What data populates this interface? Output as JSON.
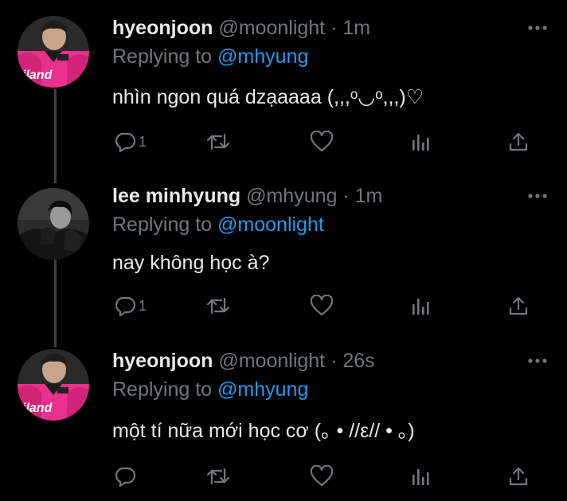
{
  "tweets": [
    {
      "name": "hyeonjoon",
      "handle": "@moonlight",
      "sep": "·",
      "time": "1m",
      "replying_prefix": "Replying to",
      "replying_to": "@mhyung",
      "text": "nhìn ngon quá dzạaaaa (,,,ᵒ◡ᵒ,,,)♡",
      "reply_count": "1",
      "avatar": "pink-jersey-avatar"
    },
    {
      "name": "lee minhyung",
      "handle": "@mhyung",
      "sep": "·",
      "time": "1m",
      "replying_prefix": "Replying to",
      "replying_to": "@moonlight",
      "text": "nay không học à?",
      "reply_count": "1",
      "avatar": "monochrome-avatar"
    },
    {
      "name": "hyeonjoon",
      "handle": "@moonlight",
      "sep": "·",
      "time": "26s",
      "replying_prefix": "Replying to",
      "replying_to": "@mhyung",
      "text": "một tí nữa mới học cơ (｡ • //ε// • ｡)",
      "reply_count": "",
      "avatar": "pink-jersey-avatar"
    }
  ],
  "avatar_label": "iland",
  "icons": {
    "more": "more-icon",
    "reply": "reply-icon",
    "retweet": "retweet-icon",
    "like": "heart-icon",
    "views": "views-icon",
    "share": "share-icon"
  },
  "colors": {
    "background": "#000000",
    "text": "#e7e9ea",
    "secondary": "#71767b",
    "accent": "#1d9bf0",
    "thread_line": "#3e4144",
    "avatar_pink": "#e8308c"
  }
}
